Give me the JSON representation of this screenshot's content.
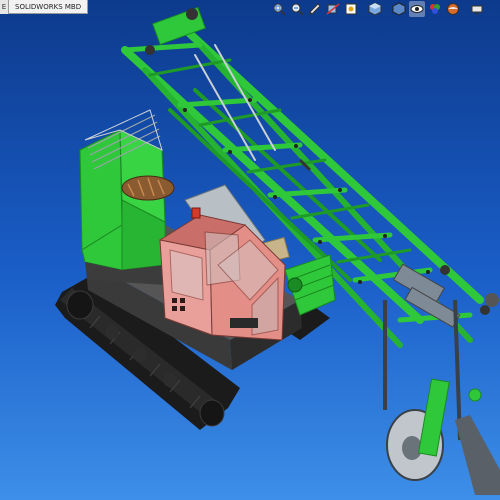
{
  "app": {
    "name": "SOLIDWORKS"
  },
  "tabs": {
    "cut_label": "E",
    "items": [
      {
        "label": "SOLIDWORKS MBD"
      }
    ]
  },
  "view_toolbar": {
    "buttons": [
      {
        "icon": "zoom-to-fit-icon"
      },
      {
        "icon": "zoom-to-area-icon"
      },
      {
        "icon": "previous-view-icon"
      },
      {
        "icon": "section-view-icon"
      },
      {
        "icon": "dynamic-annotation-views-icon"
      },
      {
        "icon": "view-orientation-icon"
      },
      {
        "icon": "display-style-icon"
      },
      {
        "icon": "hide-show-items-icon",
        "active": true
      },
      {
        "icon": "edit-appearance-icon"
      },
      {
        "icon": "apply-scene-icon"
      },
      {
        "icon": "view-settings-icon"
      }
    ]
  },
  "colors": {
    "frame_green": "#2fc83a",
    "frame_dark_green": "#1a8a22",
    "track_black": "#1b1b1b",
    "cab_pink": "#e9a09a",
    "hydraulic_grey": "#7e8a96",
    "background_top": "#0d3a8c",
    "background_bottom": "#3d8fe8"
  }
}
